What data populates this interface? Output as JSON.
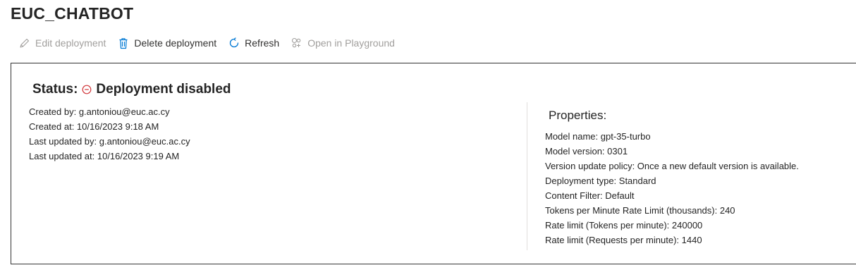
{
  "page": {
    "title": "EUC_CHATBOT"
  },
  "toolbar": {
    "edit": {
      "label": "Edit deployment",
      "icon": "pencil-icon"
    },
    "delete": {
      "label": "Delete deployment",
      "icon": "trash-icon"
    },
    "refresh": {
      "label": "Refresh",
      "icon": "refresh-icon"
    },
    "playground": {
      "label": "Open in Playground",
      "icon": "playground-icon"
    }
  },
  "status": {
    "label": "Status:",
    "value": "Deployment disabled",
    "icon": "minus-circle-icon",
    "color": "#d13438"
  },
  "meta": {
    "created_by": "Created by: g.antoniou@euc.ac.cy",
    "created_at": "Created at: 10/16/2023 9:18 AM",
    "updated_by": "Last updated by: g.antoniou@euc.ac.cy",
    "updated_at": "Last updated at: 10/16/2023 9:19 AM"
  },
  "properties": {
    "title": "Properties:",
    "items": [
      "Model name: gpt-35-turbo",
      "Model version: 0301",
      "Version update policy: Once a new default version is available.",
      "Deployment type: Standard",
      "Content Filter: Default",
      "Tokens per Minute Rate Limit (thousands): 240",
      "Rate limit (Tokens per minute): 240000",
      "Rate limit (Requests per minute): 1440"
    ]
  },
  "colors": {
    "accent": "#0078d4",
    "disabled": "#a19f9d",
    "text": "#242424"
  }
}
